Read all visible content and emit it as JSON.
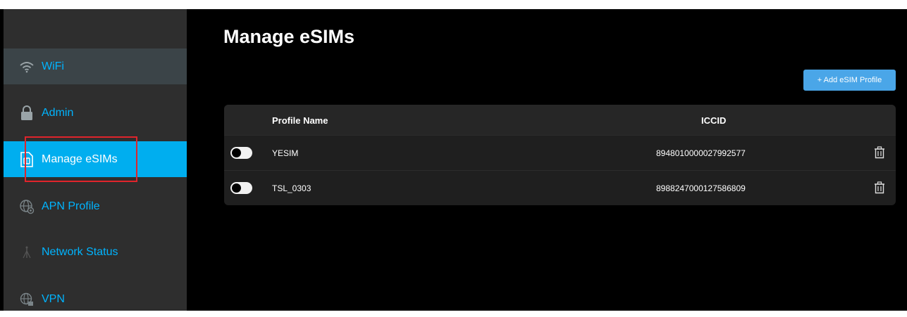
{
  "sidebar": {
    "items": [
      {
        "label": "WiFi",
        "icon": "wifi-icon"
      },
      {
        "label": "Admin",
        "icon": "lock-icon"
      },
      {
        "label": "Manage eSIMs",
        "icon": "sim-card-icon"
      },
      {
        "label": "APN Profile",
        "icon": "globe-gear-icon"
      },
      {
        "label": "Network Status",
        "icon": "antenna-icon"
      },
      {
        "label": "VPN",
        "icon": "globe-lock-icon"
      }
    ],
    "active_item": "Manage eSIMs"
  },
  "main": {
    "title": "Manage eSIMs",
    "add_button_label": "+ Add eSIM Profile",
    "table": {
      "columns": [
        "Profile Name",
        "ICCID"
      ],
      "rows": [
        {
          "enabled": false,
          "profile_name": "YESIM",
          "iccid": "8948010000027992577"
        },
        {
          "enabled": false,
          "profile_name": "TSL_0303",
          "iccid": "8988247000127586809"
        }
      ]
    }
  },
  "colors": {
    "accent": "#00aeef",
    "link": "#00b4ff",
    "button": "#4aa6e8",
    "sidebar_bg": "#2e2e2e",
    "page_bg": "#000000",
    "highlight": "#e0242b"
  }
}
